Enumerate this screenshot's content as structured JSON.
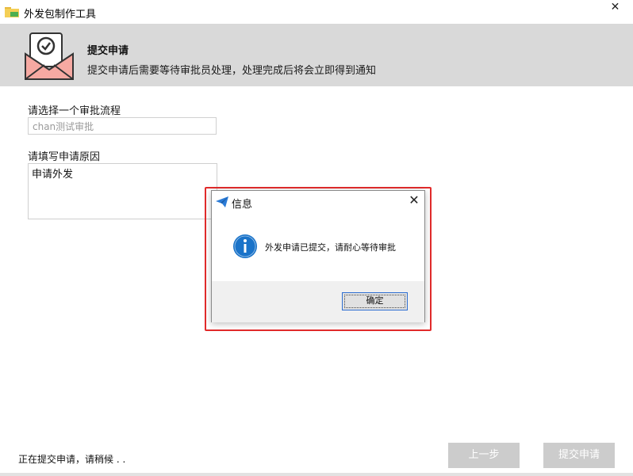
{
  "window": {
    "title": "外发包制作工具",
    "close_glyph": "✕"
  },
  "header": {
    "title": "提交申请",
    "subtitle": "提交申请后需要等待审批员处理，处理完成后将会立即得到通知",
    "icon": "mail-check-icon"
  },
  "form": {
    "flow_label": "请选择一个审批流程",
    "flow_value": "chan测试审批",
    "reason_label": "请填写申请原因",
    "reason_value": "申请外发"
  },
  "status_text": "正在提交申请，请稍候 . .",
  "buttons": {
    "prev_label": "上一步",
    "submit_label": "提交申请"
  },
  "dialog": {
    "title": "信息",
    "message": "外发申请已提交，请耐心等待审批",
    "ok_label": "确定",
    "close_glyph": "✕",
    "info_icon": "info-icon",
    "title_icon": "paper-plane-icon"
  },
  "colors": {
    "highlight": "#e22b2b",
    "header_bg": "#d9d9d9",
    "info_blue": "#1a73c9",
    "disabled_btn": "#cccccc"
  }
}
